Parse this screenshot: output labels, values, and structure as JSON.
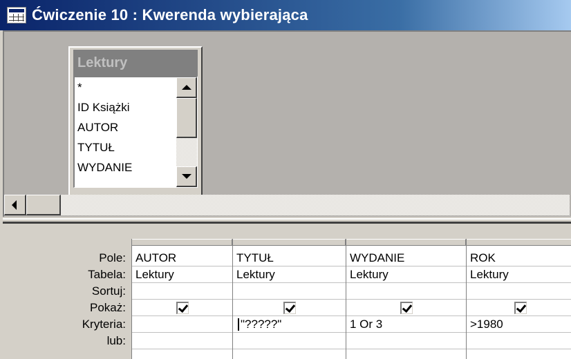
{
  "window": {
    "title": "Ćwiczenie 10 : Kwerenda wybierająca",
    "icon": "query-icon"
  },
  "table": {
    "name": "Lektury",
    "fields": [
      "*",
      "ID Książki",
      "AUTOR",
      "TYTUŁ",
      "WYDANIE"
    ]
  },
  "grid": {
    "row_labels": [
      "Pole:",
      "Tabela:",
      "Sortuj:",
      "Pokaż:",
      "Kryteria:",
      "lub:"
    ],
    "columns": [
      {
        "field": "AUTOR",
        "table": "Lektury",
        "sort": "",
        "show": true,
        "criteria": "",
        "or": ""
      },
      {
        "field": "TYTUŁ",
        "table": "Lektury",
        "sort": "",
        "show": true,
        "criteria": "\"?????\"",
        "or": ""
      },
      {
        "field": "WYDANIE",
        "table": "Lektury",
        "sort": "",
        "show": true,
        "criteria": "1 Or 3",
        "or": ""
      },
      {
        "field": "ROK",
        "table": "Lektury",
        "sort": "",
        "show": true,
        "criteria": ">1980",
        "or": ""
      }
    ]
  }
}
